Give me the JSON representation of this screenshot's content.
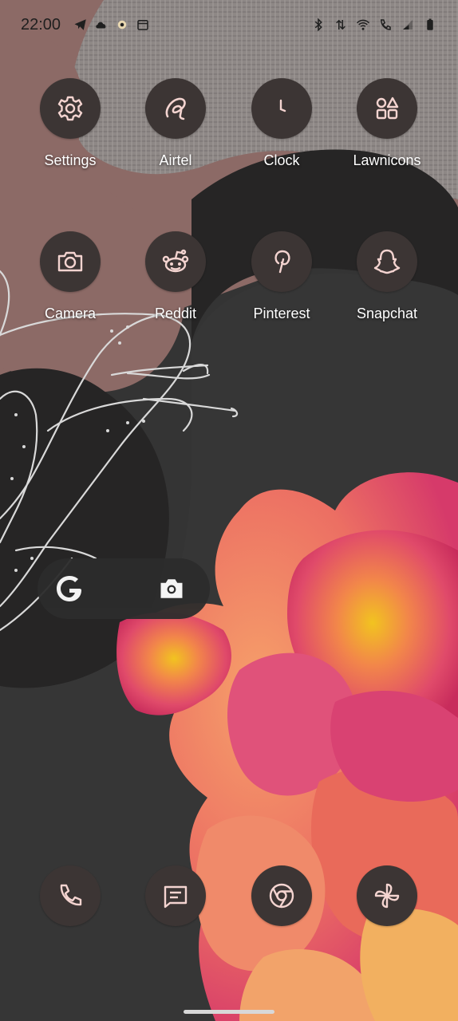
{
  "status_bar": {
    "time": "22:00",
    "left_icons": [
      "telegram-icon",
      "cloud-icon",
      "notification-dot-icon",
      "calendar-icon"
    ],
    "right_icons": [
      "bluetooth-icon",
      "data-arrows-icon",
      "wifi-icon",
      "call-icon",
      "signal-icon",
      "battery-icon"
    ]
  },
  "apps": [
    {
      "label": "Settings",
      "icon": "gear-icon"
    },
    {
      "label": "Airtel",
      "icon": "airtel-icon"
    },
    {
      "label": "Clock",
      "icon": "clock-icon"
    },
    {
      "label": "Lawnicons",
      "icon": "shapes-icon"
    },
    {
      "label": "Camera",
      "icon": "camera-icon"
    },
    {
      "label": "Reddit",
      "icon": "reddit-icon"
    },
    {
      "label": "Pinterest",
      "icon": "pinterest-icon"
    },
    {
      "label": "Snapchat",
      "icon": "ghost-icon"
    }
  ],
  "search_widget": {
    "left_icon": "google-g-icon",
    "right_icon": "lens-camera-icon"
  },
  "dock": [
    {
      "icon": "phone-icon"
    },
    {
      "icon": "messages-icon"
    },
    {
      "icon": "chrome-icon"
    },
    {
      "icon": "pinwheel-icon"
    }
  ],
  "colors": {
    "icon_bg": "#3c3534",
    "icon_fg": "#f4d4d0",
    "mauve": "#8c6a66",
    "dark_blob": "#262525",
    "background": "#343434"
  }
}
